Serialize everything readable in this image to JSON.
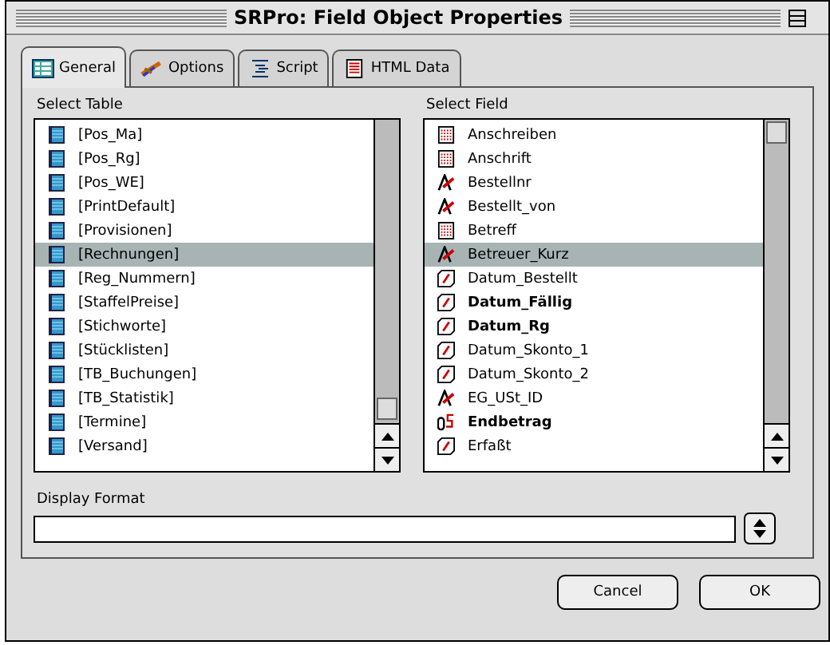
{
  "window": {
    "title": "SRPro: Field Object Properties"
  },
  "tabs": [
    {
      "label": "General",
      "selected": true
    },
    {
      "label": "Options",
      "selected": false
    },
    {
      "label": "Script",
      "selected": false
    },
    {
      "label": "HTML Data",
      "selected": false
    }
  ],
  "select_table": {
    "label": "Select Table",
    "items": [
      {
        "name": "[Pos_Ma]",
        "selected": false
      },
      {
        "name": "[Pos_Rg]",
        "selected": false
      },
      {
        "name": "[Pos_WE]",
        "selected": false
      },
      {
        "name": "[PrintDefault]",
        "selected": false
      },
      {
        "name": "[Provisionen]",
        "selected": false
      },
      {
        "name": "[Rechnungen]",
        "selected": true
      },
      {
        "name": "[Reg_Nummern]",
        "selected": false
      },
      {
        "name": "[StaffelPreise]",
        "selected": false
      },
      {
        "name": "[Stichworte]",
        "selected": false
      },
      {
        "name": "[Stücklisten]",
        "selected": false
      },
      {
        "name": "[TB_Buchungen]",
        "selected": false
      },
      {
        "name": "[TB_Statistik]",
        "selected": false
      },
      {
        "name": "[Termine]",
        "selected": false
      },
      {
        "name": "[Versand]",
        "selected": false
      }
    ]
  },
  "select_field": {
    "label": "Select Field",
    "items": [
      {
        "name": "Anschreiben",
        "kind": "text",
        "bold": false,
        "selected": false
      },
      {
        "name": "Anschrift",
        "kind": "text",
        "bold": false,
        "selected": false
      },
      {
        "name": "Bestellnr",
        "kind": "string",
        "bold": false,
        "selected": false
      },
      {
        "name": "Bestellt_von",
        "kind": "string",
        "bold": false,
        "selected": false
      },
      {
        "name": "Betreff",
        "kind": "text",
        "bold": false,
        "selected": false
      },
      {
        "name": "Betreuer_Kurz",
        "kind": "string",
        "bold": false,
        "selected": true
      },
      {
        "name": "Datum_Bestellt",
        "kind": "date",
        "bold": false,
        "selected": false
      },
      {
        "name": "Datum_Fällig",
        "kind": "date",
        "bold": true,
        "selected": false
      },
      {
        "name": "Datum_Rg",
        "kind": "date",
        "bold": true,
        "selected": false
      },
      {
        "name": "Datum_Skonto_1",
        "kind": "date",
        "bold": false,
        "selected": false
      },
      {
        "name": "Datum_Skonto_2",
        "kind": "date",
        "bold": false,
        "selected": false
      },
      {
        "name": "EG_USt_ID",
        "kind": "string",
        "bold": false,
        "selected": false
      },
      {
        "name": "Endbetrag",
        "kind": "number",
        "bold": true,
        "selected": false
      },
      {
        "name": "Erfaßt",
        "kind": "date",
        "bold": false,
        "selected": false
      }
    ]
  },
  "display_format": {
    "label": "Display Format"
  },
  "buttons": [
    "Cancel",
    "OK"
  ]
}
